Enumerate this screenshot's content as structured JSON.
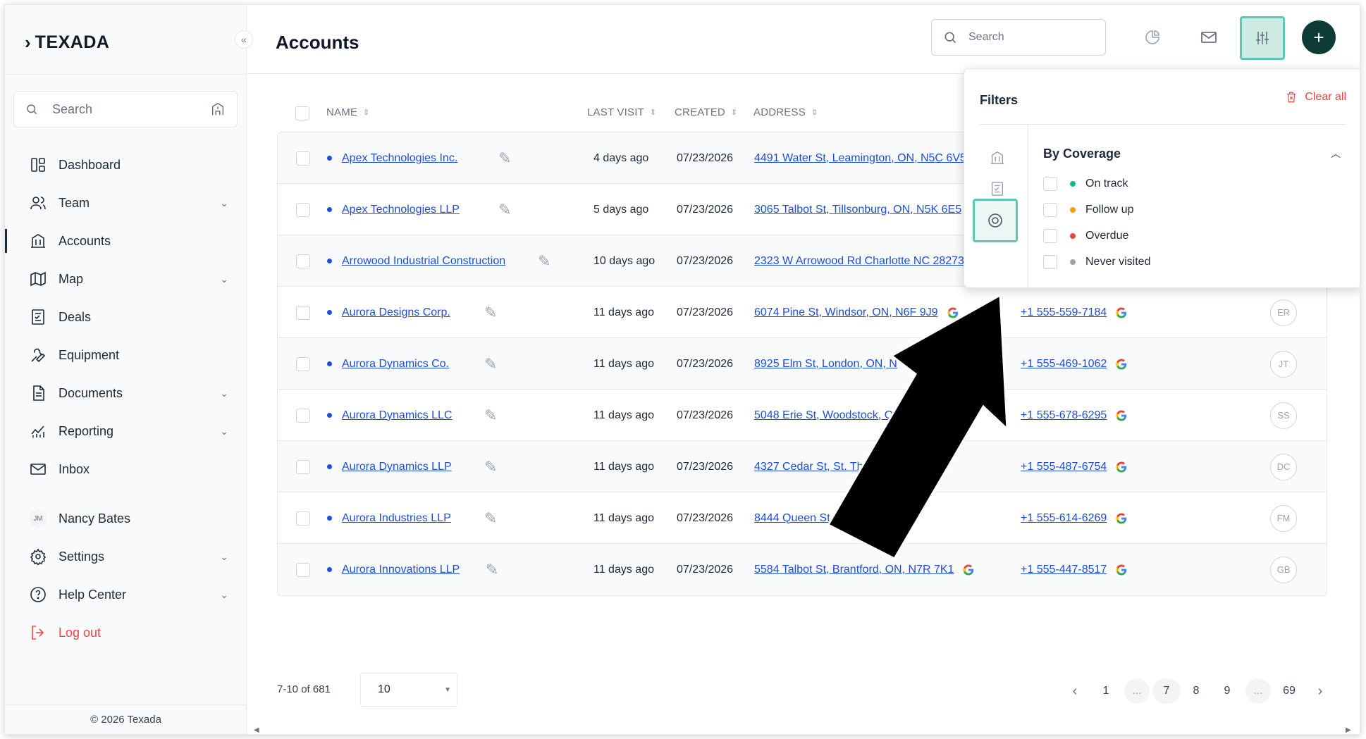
{
  "colors": {
    "accent": "#5fc6b3",
    "accent_bg": "#cdeae3",
    "primary_dark": "#0d3b35",
    "link": "#1d4ed8",
    "danger": "#ef4444",
    "on_track": "#10b981",
    "follow_up": "#f59e0b",
    "overdue": "#ef4444",
    "never_visited": "#9ca3af"
  },
  "brand": {
    "logo_mark": "›",
    "name": "TEXADA"
  },
  "sidebar": {
    "collapse_icon": "«",
    "search_placeholder": "Search",
    "items": [
      {
        "label": "Dashboard",
        "icon": "dashboard-icon",
        "expandable": false
      },
      {
        "label": "Team",
        "icon": "team-icon",
        "expandable": true
      },
      {
        "label": "Accounts",
        "icon": "accounts-icon",
        "expandable": false,
        "active": true
      },
      {
        "label": "Map",
        "icon": "map-icon",
        "expandable": true
      },
      {
        "label": "Deals",
        "icon": "deals-icon",
        "expandable": false
      },
      {
        "label": "Equipment",
        "icon": "equipment-icon",
        "expandable": false
      },
      {
        "label": "Documents",
        "icon": "documents-icon",
        "expandable": true
      },
      {
        "label": "Reporting",
        "icon": "reporting-icon",
        "expandable": true
      },
      {
        "label": "Inbox",
        "icon": "inbox-icon",
        "expandable": false
      }
    ],
    "user": {
      "initials": "JM",
      "name": "Nancy Bates"
    },
    "settings_label": "Settings",
    "help_label": "Help Center",
    "logout_label": "Log out",
    "footer": "© 2026 Texada"
  },
  "header": {
    "title": "Accounts",
    "search_placeholder": "Search",
    "add_label": "+"
  },
  "table": {
    "columns": {
      "name": "NAME",
      "last_visit": "LAST VISIT",
      "created": "CREATED",
      "address": "ADDRESS"
    },
    "rows": [
      {
        "name": "Apex Technologies Inc.",
        "last_visit": "4 days ago",
        "created": "07/23/2026",
        "address": "4491 Water St, Leamington, ON, N5C 6V5",
        "phone": "",
        "owner": ""
      },
      {
        "name": "Apex Technologies LLP",
        "last_visit": "5 days ago",
        "created": "07/23/2026",
        "address": "3065 Talbot St, Tillsonburg, ON, N5K 6E5",
        "phone": "",
        "owner": ""
      },
      {
        "name": "Arrowood Industrial Construction",
        "last_visit": "10 days ago",
        "created": "07/23/2026",
        "address": "2323 W Arrowood Rd Charlotte NC 28273",
        "phone": "",
        "owner": ""
      },
      {
        "name": "Aurora Designs Corp.",
        "last_visit": "11 days ago",
        "created": "07/23/2026",
        "address": "6074 Pine St, Windsor, ON, N6F 9J9",
        "phone": "+1 555-559-7184",
        "owner": "ER"
      },
      {
        "name": "Aurora Dynamics Co.",
        "last_visit": "11 days ago",
        "created": "07/23/2026",
        "address": "8925 Elm St, London, ON, N",
        "phone": "+1 555-469-1062",
        "owner": "JT"
      },
      {
        "name": "Aurora Dynamics LLC",
        "last_visit": "11 days ago",
        "created": "07/23/2026",
        "address": "5048 Erie St, Woodstock, ON",
        "phone": "+1 555-678-6295",
        "owner": "SS"
      },
      {
        "name": "Aurora Dynamics LLP",
        "last_visit": "11 days ago",
        "created": "07/23/2026",
        "address": "4327 Cedar St, St. Tho",
        "phone": "+1 555-487-6754",
        "owner": "DC"
      },
      {
        "name": "Aurora Industries LLP",
        "last_visit": "11 days ago",
        "created": "07/23/2026",
        "address": "8444 Queen St",
        "phone": "+1 555-614-6269",
        "owner": "FM"
      },
      {
        "name": "Aurora Innovations LLP",
        "last_visit": "11 days ago",
        "created": "07/23/2026",
        "address": "5584 Talbot St, Brantford, ON, N7R 7K1",
        "phone": "+1 555-447-8517",
        "owner": "GB"
      }
    ]
  },
  "pagination": {
    "range": "7-10 of 681",
    "page_size": "10",
    "pages": [
      "1",
      "...",
      "7",
      "8",
      "9",
      "...",
      "69"
    ],
    "current": "7"
  },
  "filters": {
    "title": "Filters",
    "clear_all": "Clear all",
    "section_title": "By Coverage",
    "options": [
      {
        "label": "On track",
        "color": "#10b981"
      },
      {
        "label": "Follow up",
        "color": "#f59e0b"
      },
      {
        "label": "Overdue",
        "color": "#ef4444"
      },
      {
        "label": "Never visited",
        "color": "#9ca3af"
      }
    ]
  }
}
